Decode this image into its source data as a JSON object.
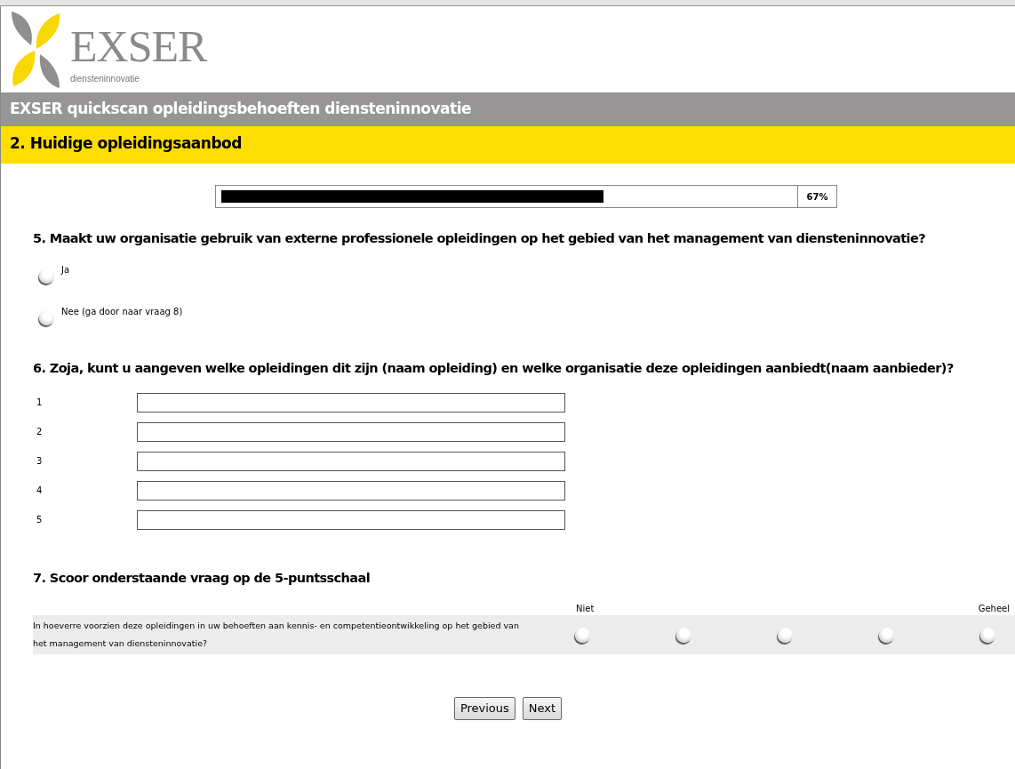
{
  "logo": {
    "name": "EXSER",
    "tagline": "diensteninnovatie"
  },
  "survey_title": "EXSER quickscan opleidingsbehoeften diensteninnovatie",
  "section_title": "2. Huidige opleidingsaanbod",
  "progress": {
    "level": 0.67,
    "reading": "67%"
  },
  "question_5": {
    "title": "5. Maakt uw organisatie gebruik van externe professionele opleidingen op het gebied van het management van diensteninnovatie?",
    "options": [
      {
        "label": "Ja",
        "selected": false
      },
      {
        "label": "Nee (ga door naar vraag 8)",
        "selected": false
      }
    ]
  },
  "question_6": {
    "title": "6. Zoja, kunt u aangeven welke opleidingen dit zijn (naam opleiding) en welke organisatie deze opleidingen aanbiedt(naam aanbieder)?",
    "fields": [
      {
        "label": "1"
      },
      {
        "label": "2"
      },
      {
        "label": "3"
      },
      {
        "label": "4"
      },
      {
        "label": "5"
      }
    ]
  },
  "question_7": {
    "title": "7. Scoor onderstaande vraag op de 5-puntsschaal",
    "low_label": "Niet",
    "high_label": "Geheel",
    "statement": "In hoeverre voorzien deze opleidingen in uw behoeften aan kennis- en competentieontwikkeling op het gebied van het management van diensteninnovatie?",
    "scale": [
      {
        "selected": false
      },
      {
        "selected": false
      },
      {
        "selected": false
      },
      {
        "selected": false
      },
      {
        "selected": false
      }
    ]
  },
  "buttons": [
    "Previous",
    "Next"
  ]
}
